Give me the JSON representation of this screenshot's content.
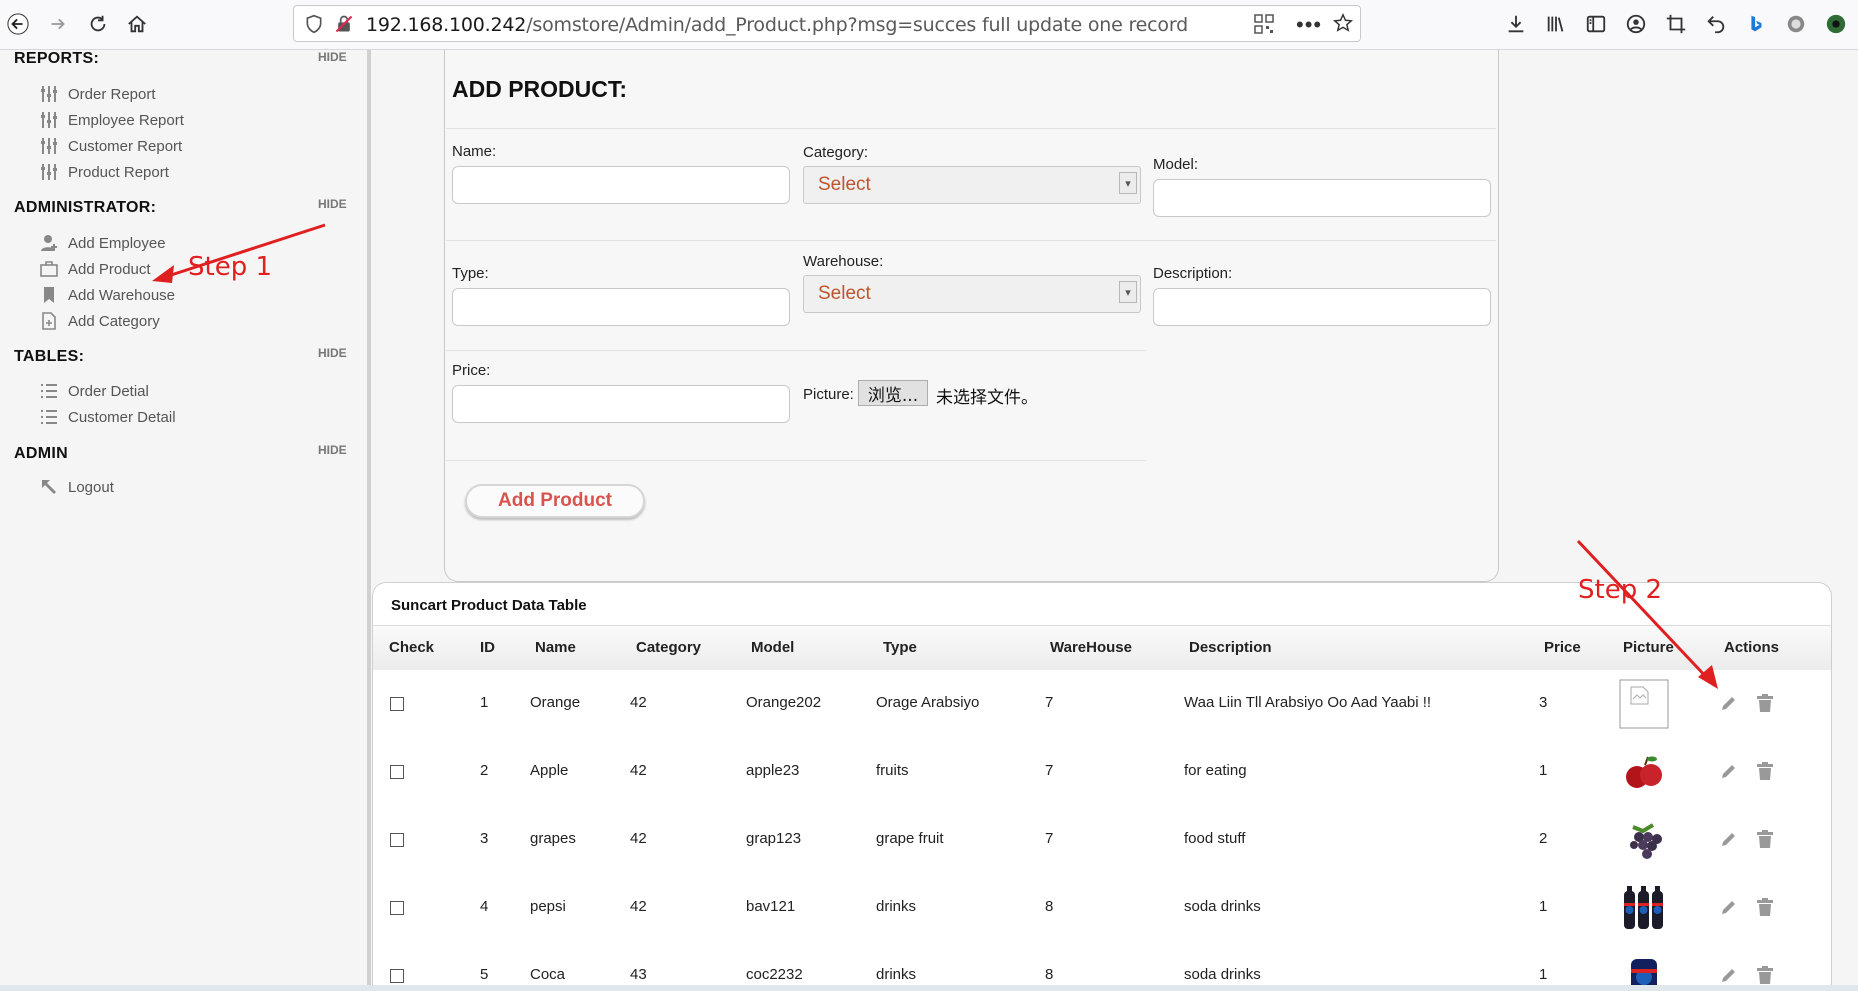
{
  "browser": {
    "url_host": "192.168.100.242",
    "url_path": "/somstore/Admin/add_Product.php?msg=succes full update one record"
  },
  "sidebar": {
    "sections": [
      {
        "title": "REPORTS:",
        "hide": "HIDE",
        "items": [
          "Order Report",
          "Employee Report",
          "Customer Report",
          "Product Report"
        ]
      },
      {
        "title": "ADMINISTRATOR:",
        "hide": "HIDE",
        "items": [
          "Add Employee",
          "Add Product",
          "Add Warehouse",
          "Add Category"
        ]
      },
      {
        "title": "TABLES:",
        "hide": "HIDE",
        "items": [
          "Order Detial",
          "Customer Detail"
        ]
      },
      {
        "title": "ADMIN",
        "hide": "HIDE",
        "items": [
          "Logout"
        ]
      }
    ]
  },
  "form": {
    "title": "ADD PRODUCT:",
    "name_label": "Name:",
    "category_label": "Category:",
    "category_value": "Select",
    "model_label": "Model:",
    "type_label": "Type:",
    "warehouse_label": "Warehouse:",
    "warehouse_value": "Select",
    "description_label": "Description:",
    "price_label": "Price:",
    "picture_label": "Picture:",
    "browse_label": "浏览...",
    "no_file_text": "未选择文件。",
    "submit_label": "Add Product"
  },
  "table": {
    "title": "Suncart Product Data Table",
    "headers": [
      "Check",
      "ID",
      "Name",
      "Category",
      "Model",
      "Type",
      "WareHouse",
      "Description",
      "Price",
      "Picture",
      "Actions"
    ],
    "rows": [
      {
        "id": "1",
        "name": "Orange",
        "category": "42",
        "model": "Orange202",
        "type": "Orage Arabsiyo",
        "warehouse": "7",
        "description": "Waa Liin Tll Arabsiyo Oo Aad Yaabi !!",
        "price": "3",
        "picture": "broken-image"
      },
      {
        "id": "2",
        "name": "Apple",
        "category": "42",
        "model": "apple23",
        "type": "fruits",
        "warehouse": "7",
        "description": "for eating",
        "price": "1",
        "picture": "apple"
      },
      {
        "id": "3",
        "name": "grapes",
        "category": "42",
        "model": "grap123",
        "type": "grape fruit",
        "warehouse": "7",
        "description": "food stuff",
        "price": "2",
        "picture": "grapes"
      },
      {
        "id": "4",
        "name": "pepsi",
        "category": "42",
        "model": "bav121",
        "type": "drinks",
        "warehouse": "8",
        "description": "soda drinks",
        "price": "1",
        "picture": "pepsi-bottles"
      },
      {
        "id": "5",
        "name": "Coca",
        "category": "43",
        "model": "coc2232",
        "type": "drinks",
        "warehouse": "8",
        "description": "soda drinks",
        "price": "1",
        "picture": "pepsi-bottle"
      }
    ]
  },
  "annotations": {
    "step1": "Step 1",
    "step2": "Step 2"
  },
  "colors": {
    "select_text": "#c0542b",
    "submit_text": "#d9534f",
    "annotation": "#e02020"
  }
}
